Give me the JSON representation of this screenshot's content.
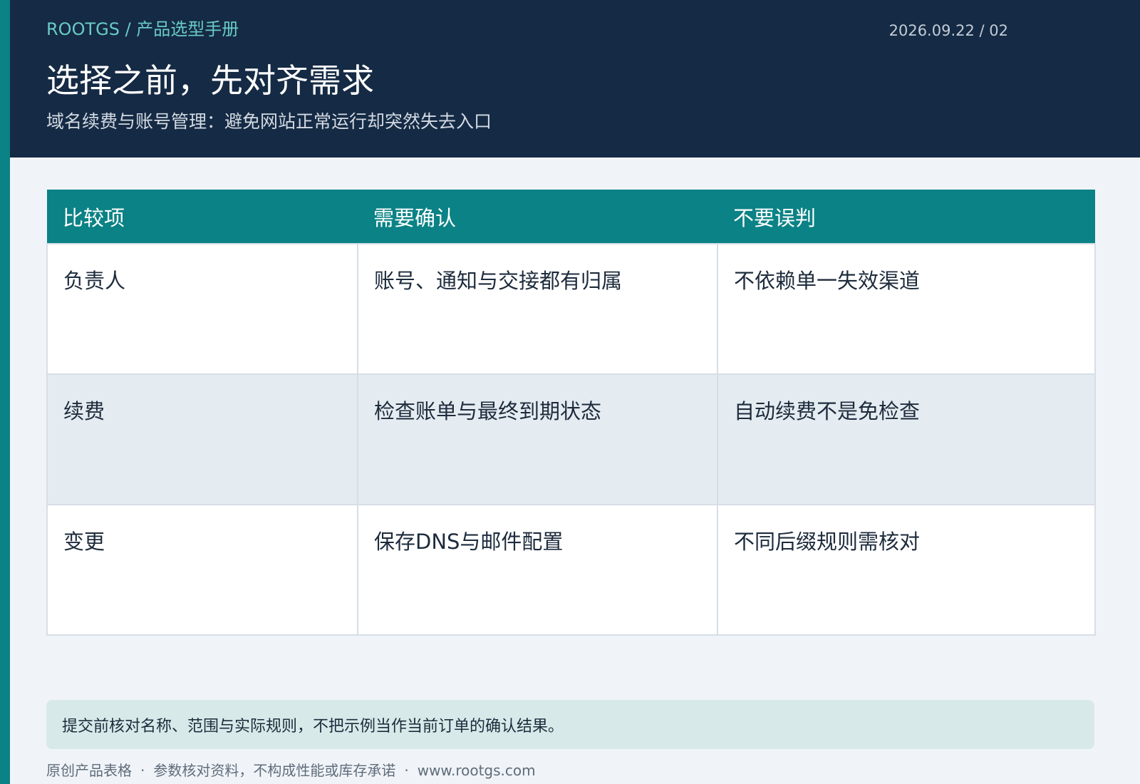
{
  "header": {
    "brand": "ROOTGS / 产品选型手册",
    "date": "2026.09.22 / 02",
    "title": "选择之前，先对齐需求",
    "subtitle": "域名续费与账号管理：避免网站正常运行却突然失去入口"
  },
  "table": {
    "columns": [
      "比较项",
      "需要确认",
      "不要误判"
    ],
    "rows": [
      [
        "负责人",
        "账号、通知与交接都有归属",
        "不依赖单一失效渠道"
      ],
      [
        "续费",
        "检查账单与最终到期状态",
        "自动续费不是免检查"
      ],
      [
        "变更",
        "保存DNS与邮件配置",
        "不同后缀规则需核对"
      ]
    ]
  },
  "note": "提交前核对名称、范围与实际规则，不把示例当作当前订单的确认结果。",
  "footer": {
    "items": [
      "原创产品表格",
      "参数核对资料，不构成性能或库存承诺",
      "www.rootgs.com"
    ],
    "separator": "·"
  },
  "colors": {
    "accent": "#0b8285",
    "header_bg": "#152a44",
    "brand_text": "#68cbc6",
    "page_bg": "#f0f4f8",
    "row_alt": "#e5ecf1",
    "note_bg": "#d7eae9"
  }
}
